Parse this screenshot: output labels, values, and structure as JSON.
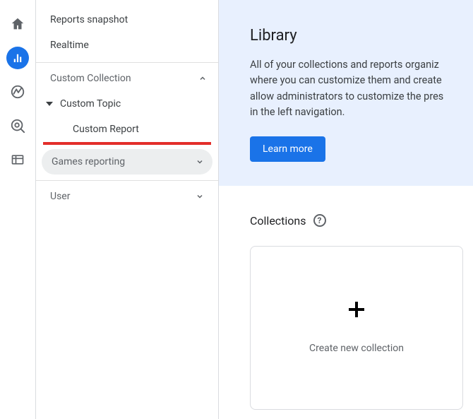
{
  "sidebar": {
    "reports_snapshot": "Reports snapshot",
    "realtime": "Realtime",
    "custom_collection": "Custom Collection",
    "custom_topic": "Custom Topic",
    "custom_report": "Custom Report",
    "games_reporting": "Games reporting",
    "user": "User"
  },
  "hero": {
    "title": "Library",
    "body_1": "All of your collections and reports organiz",
    "body_2": "where you can customize them and create",
    "body_3": "allow administrators to customize the pres",
    "body_4": "in the left navigation.",
    "learn_more": "Learn more"
  },
  "collections": {
    "heading": "Collections",
    "create_label": "Create new collection"
  }
}
